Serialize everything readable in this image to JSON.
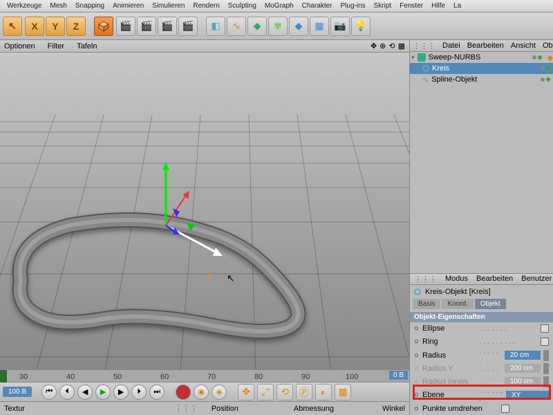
{
  "menu": [
    "Werkzeuge",
    "Mesh",
    "Snapping",
    "Animieren",
    "Simulieren",
    "Rendern",
    "Sculpting",
    "MoGraph",
    "Charakter",
    "Plug-ins",
    "Skript",
    "Fenster",
    "Hilfe",
    "La"
  ],
  "axes": [
    "X",
    "Y",
    "Z"
  ],
  "leftbar": {
    "items": [
      "Optionen",
      "Filter",
      "Tafeln"
    ]
  },
  "rightmenu1": [
    "Datei",
    "Bearbeiten",
    "Ansicht",
    "Ob"
  ],
  "tree": [
    {
      "name": "Sweep-NURBS",
      "lvl": 0,
      "icon": "sweep"
    },
    {
      "name": "Kreis",
      "lvl": 1,
      "icon": "circle"
    },
    {
      "name": "Spline-Objekt",
      "lvl": 1,
      "icon": "spline"
    }
  ],
  "attrmenu": [
    "Modus",
    "Bearbeiten",
    "Benutzer"
  ],
  "objtitle": "Kreis-Objekt [Kreis]",
  "tabs": [
    "Basis",
    "Koord.",
    "Objekt"
  ],
  "section": "Objekt-Eigenschaften",
  "props": [
    {
      "label": "Ellipse",
      "type": "check",
      "val": false,
      "enabled": true
    },
    {
      "label": "Ring",
      "type": "check",
      "val": false,
      "enabled": true
    },
    {
      "label": "Radius",
      "type": "num",
      "val": "20 cm",
      "enabled": true
    },
    {
      "label": "Radius Y",
      "type": "num",
      "val": "200 cm",
      "enabled": false
    },
    {
      "label": "Radius Innen.",
      "type": "num",
      "val": "100 cm",
      "enabled": false
    },
    {
      "label": "Ebene",
      "type": "sel",
      "val": "XY",
      "enabled": true,
      "hl": true
    },
    {
      "label": "Punkte umdrehen",
      "type": "check",
      "val": false,
      "enabled": true
    }
  ],
  "timeline": {
    "ticks": [
      30,
      40,
      50,
      60,
      70,
      80,
      90,
      100
    ],
    "end": "0 B",
    "frame": "100 B"
  },
  "bottom": {
    "textur": "Textur",
    "pos": "Position",
    "abm": "Abmessung",
    "wink": "Winkel"
  }
}
